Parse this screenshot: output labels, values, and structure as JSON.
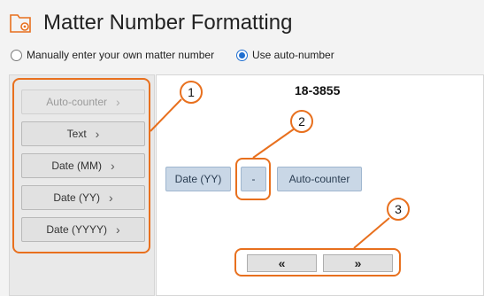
{
  "header": {
    "title": "Matter Number Formatting",
    "icon": "folder-gear-icon"
  },
  "options": {
    "manual_label": "Manually enter your own matter number",
    "auto_label": "Use auto-number",
    "selected": "auto"
  },
  "token_buttons": [
    {
      "label": "Auto-counter",
      "disabled": true
    },
    {
      "label": "Text",
      "disabled": false
    },
    {
      "label": "Date (MM)",
      "disabled": false
    },
    {
      "label": "Date (YY)",
      "disabled": false
    },
    {
      "label": "Date (YYYY)",
      "disabled": false
    }
  ],
  "preview": {
    "value": "18-3855"
  },
  "segments": [
    {
      "label": "Date (YY)"
    },
    {
      "label": "-"
    },
    {
      "label": "Auto-counter"
    }
  ],
  "nav": {
    "left": "«",
    "right": "»"
  },
  "callouts": [
    "1",
    "2",
    "3"
  ],
  "colors": {
    "accent": "#e8701e",
    "segment": "#c9d7e6",
    "radio": "#1f6fd1"
  }
}
